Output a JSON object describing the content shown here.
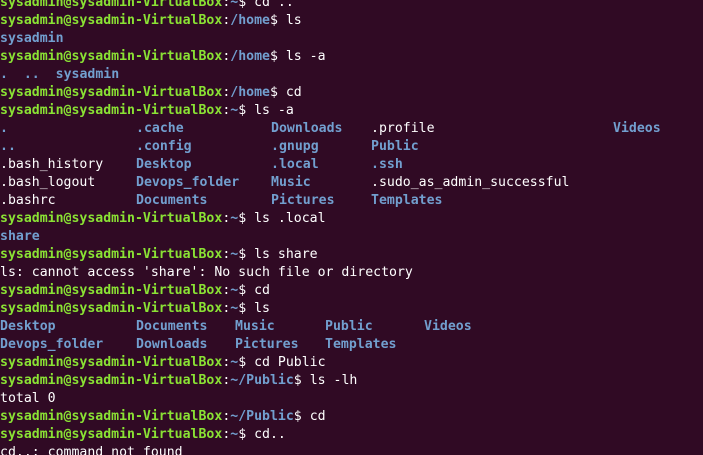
{
  "colors": {
    "background": "#300a24",
    "prompt_user": "#8ae234",
    "directory": "#729fcf",
    "text": "#ffffff"
  },
  "prompt_user_host": "sysadmin@sysadmin-VirtualBox",
  "lines": [
    {
      "type": "prompt",
      "path": "~",
      "command": "cd .."
    },
    {
      "type": "prompt",
      "path": "/home",
      "command": "ls"
    },
    {
      "type": "out",
      "cells": [
        {
          "t": "sysadmin",
          "c": "dir"
        }
      ]
    },
    {
      "type": "prompt",
      "path": "/home",
      "command": "ls -a"
    },
    {
      "type": "out",
      "cells": [
        {
          "t": ".",
          "c": "dir"
        },
        {
          "t": "..",
          "c": "dir"
        },
        {
          "t": "sysadmin",
          "c": "dir"
        }
      ]
    },
    {
      "type": "prompt",
      "path": "/home",
      "command": "cd"
    },
    {
      "type": "prompt",
      "path": "~",
      "command": "ls -a"
    },
    {
      "type": "grid",
      "cols": [
        0,
        136,
        271,
        371,
        613
      ],
      "cells": [
        {
          "t": ".",
          "c": "dir"
        },
        {
          "t": ".cache",
          "c": "dir"
        },
        {
          "t": "Downloads",
          "c": "dir"
        },
        {
          "t": ".profile",
          "c": "plain"
        },
        {
          "t": "Videos",
          "c": "dir"
        }
      ]
    },
    {
      "type": "grid",
      "cols": [
        0,
        136,
        271,
        371
      ],
      "cells": [
        {
          "t": "..",
          "c": "dir"
        },
        {
          "t": ".config",
          "c": "dir"
        },
        {
          "t": ".gnupg",
          "c": "dir"
        },
        {
          "t": "Public",
          "c": "dir"
        }
      ]
    },
    {
      "type": "grid",
      "cols": [
        0,
        136,
        271,
        371
      ],
      "cells": [
        {
          "t": ".bash_history",
          "c": "plain"
        },
        {
          "t": "Desktop",
          "c": "dir"
        },
        {
          "t": ".local",
          "c": "dir"
        },
        {
          "t": ".ssh",
          "c": "dir"
        }
      ]
    },
    {
      "type": "grid",
      "cols": [
        0,
        136,
        271,
        371
      ],
      "cells": [
        {
          "t": ".bash_logout",
          "c": "plain"
        },
        {
          "t": "Devops_folder",
          "c": "dir"
        },
        {
          "t": "Music",
          "c": "dir"
        },
        {
          "t": ".sudo_as_admin_successful",
          "c": "plain"
        }
      ]
    },
    {
      "type": "grid",
      "cols": [
        0,
        136,
        271,
        371
      ],
      "cells": [
        {
          "t": ".bashrc",
          "c": "plain"
        },
        {
          "t": "Documents",
          "c": "dir"
        },
        {
          "t": "Pictures",
          "c": "dir"
        },
        {
          "t": "Templates",
          "c": "dir"
        }
      ]
    },
    {
      "type": "prompt",
      "path": "~",
      "command": "ls .local"
    },
    {
      "type": "out",
      "cells": [
        {
          "t": "share",
          "c": "dir"
        }
      ]
    },
    {
      "type": "prompt",
      "path": "~",
      "command": "ls share"
    },
    {
      "type": "out",
      "cells": [
        {
          "t": "ls: cannot access 'share': No such file or directory",
          "c": "plain"
        }
      ]
    },
    {
      "type": "prompt",
      "path": "~",
      "command": "cd"
    },
    {
      "type": "prompt",
      "path": "~",
      "command": "ls"
    },
    {
      "type": "grid",
      "cols": [
        0,
        136,
        235,
        325,
        424
      ],
      "cells": [
        {
          "t": "Desktop",
          "c": "dir"
        },
        {
          "t": "Documents",
          "c": "dir"
        },
        {
          "t": "Music",
          "c": "dir"
        },
        {
          "t": "Public",
          "c": "dir"
        },
        {
          "t": "Videos",
          "c": "dir"
        }
      ]
    },
    {
      "type": "grid",
      "cols": [
        0,
        136,
        235,
        325
      ],
      "cells": [
        {
          "t": "Devops_folder",
          "c": "dir"
        },
        {
          "t": "Downloads",
          "c": "dir"
        },
        {
          "t": "Pictures",
          "c": "dir"
        },
        {
          "t": "Templates",
          "c": "dir"
        }
      ]
    },
    {
      "type": "prompt",
      "path": "~",
      "command": "cd Public"
    },
    {
      "type": "prompt",
      "path": "~/Public",
      "command": "ls -lh"
    },
    {
      "type": "out",
      "cells": [
        {
          "t": "total 0",
          "c": "plain"
        }
      ]
    },
    {
      "type": "prompt",
      "path": "~/Public",
      "command": "cd"
    },
    {
      "type": "prompt",
      "path": "~",
      "command": "cd.."
    },
    {
      "type": "out",
      "cells": [
        {
          "t": "cd..: command not found",
          "c": "plain"
        }
      ]
    }
  ]
}
